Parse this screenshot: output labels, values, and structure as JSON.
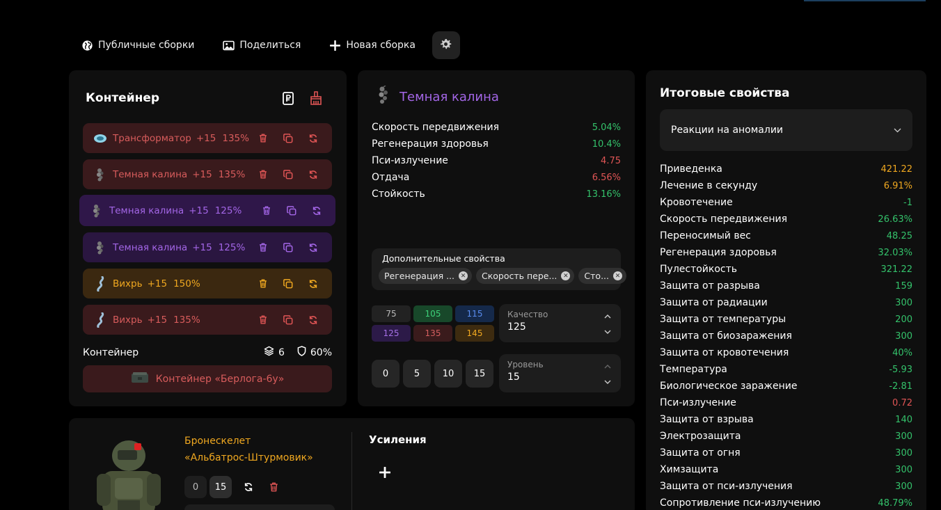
{
  "toolbar": {
    "public_builds": "Публичные сборки",
    "share": "Поделиться",
    "new_build": "Новая сборка"
  },
  "container_panel": {
    "title": "Контейнер",
    "artifacts": [
      {
        "name": "Трансформатор",
        "level": "+15",
        "quality": "135%",
        "color": "red"
      },
      {
        "name": "Темная калина",
        "level": "+15",
        "quality": "135%",
        "color": "red"
      },
      {
        "name": "Темная калина",
        "level": "+15",
        "quality": "125%",
        "color": "purple"
      },
      {
        "name": "Темная калина",
        "level": "+15",
        "quality": "125%",
        "color": "purple"
      },
      {
        "name": "Вихрь",
        "level": "+15",
        "quality": "150%",
        "color": "orange"
      },
      {
        "name": "Вихрь",
        "level": "+15",
        "quality": "135%",
        "color": "red"
      }
    ],
    "footer_label": "Контейнер",
    "slots": "6",
    "protection": "60%",
    "container_name": "Контейнер «Берлога-6у»"
  },
  "artifact_panel": {
    "name": "Темная калина",
    "stats": [
      {
        "label": "Скорость передвижения",
        "value": "5.04%",
        "tone": "g"
      },
      {
        "label": "Регенерация здоровья",
        "value": "10.4%",
        "tone": "g"
      },
      {
        "label": "Пси-излучение",
        "value": "4.75",
        "tone": "r"
      },
      {
        "label": "Отдача",
        "value": "6.56%",
        "tone": "r"
      },
      {
        "label": "Стойкость",
        "value": "13.16%",
        "tone": "g"
      }
    ],
    "additional_label": "Дополнительные свойства",
    "chips": [
      "Регенерация ...",
      "Скорость пере...",
      "Сто..."
    ],
    "quality_presets": [
      "75",
      "105",
      "115",
      "125",
      "135",
      "145"
    ],
    "quality_label": "Качество",
    "quality_value": "125",
    "level_presets": [
      "0",
      "5",
      "10",
      "15"
    ],
    "level_label": "Уровень",
    "level_value": "15"
  },
  "totals": {
    "title": "Итоговые свойства",
    "select_value": "Реакции на аномалии",
    "rows": [
      {
        "label": "Приведенка",
        "value": "421.22",
        "tone": "y"
      },
      {
        "label": "Лечение в секунду",
        "value": "6.91%",
        "tone": "y"
      },
      {
        "label": "Кровотечение",
        "value": "-1",
        "tone": "g"
      },
      {
        "label": "Скорость передвижения",
        "value": "26.63%",
        "tone": "g"
      },
      {
        "label": "Переносимый вес",
        "value": "48.25",
        "tone": "g"
      },
      {
        "label": "Регенерация здоровья",
        "value": "32.03%",
        "tone": "g"
      },
      {
        "label": "Пулестойкость",
        "value": "321.22",
        "tone": "g"
      },
      {
        "label": "Защита от разрыва",
        "value": "159",
        "tone": "g"
      },
      {
        "label": "Защита от радиации",
        "value": "300",
        "tone": "g"
      },
      {
        "label": "Защита от температуры",
        "value": "200",
        "tone": "g"
      },
      {
        "label": "Защита от биозаражения",
        "value": "300",
        "tone": "g"
      },
      {
        "label": "Защита от кровотечения",
        "value": "40%",
        "tone": "g"
      },
      {
        "label": "Температура",
        "value": "-5.93",
        "tone": "g"
      },
      {
        "label": "Биологическое заражение",
        "value": "-2.81",
        "tone": "g"
      },
      {
        "label": "Пси-излучение",
        "value": "0.72",
        "tone": "r"
      },
      {
        "label": "Защита от взрыва",
        "value": "140",
        "tone": "g"
      },
      {
        "label": "Электрозащита",
        "value": "300",
        "tone": "g"
      },
      {
        "label": "Защита от огня",
        "value": "300",
        "tone": "g"
      },
      {
        "label": "Химзащита",
        "value": "300",
        "tone": "g"
      },
      {
        "label": "Защита от пси-излучения",
        "value": "300",
        "tone": "g"
      },
      {
        "label": "Сопротивление пси-излучению",
        "value": "48.79%",
        "tone": "g"
      }
    ]
  },
  "armor": {
    "name_line1": "Бронескелет",
    "name_line2": "«Альбатрос-Штурмовик»",
    "level_min": "0",
    "level_current": "15",
    "upgrades_title": "Усиления"
  },
  "colors": {
    "green": "#34c26b",
    "red": "#e05555",
    "orange": "#f0a820",
    "purple": "#a366e6"
  }
}
